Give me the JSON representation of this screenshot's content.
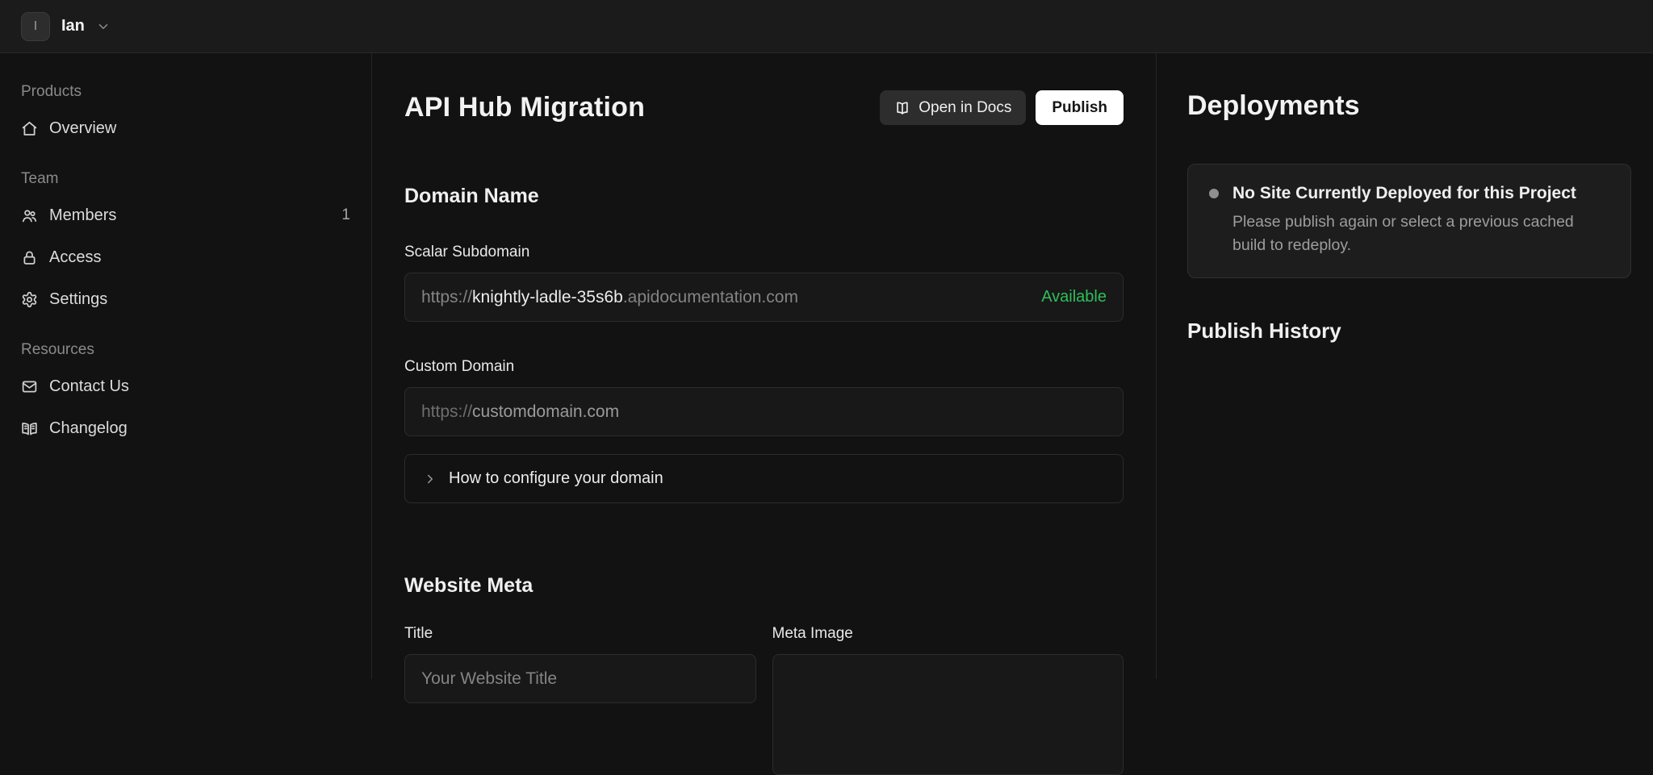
{
  "topbar": {
    "workspace_initial": "I",
    "workspace_name": "Ian"
  },
  "sidebar": {
    "sections": [
      {
        "header": "Products",
        "items": [
          {
            "label": "Overview",
            "icon": "home-icon"
          }
        ]
      },
      {
        "header": "Team",
        "items": [
          {
            "label": "Members",
            "icon": "users-icon",
            "badge": "1"
          },
          {
            "label": "Access",
            "icon": "lock-icon"
          },
          {
            "label": "Settings",
            "icon": "gear-icon"
          }
        ]
      },
      {
        "header": "Resources",
        "items": [
          {
            "label": "Contact Us",
            "icon": "mail-icon"
          },
          {
            "label": "Changelog",
            "icon": "book-icon"
          }
        ]
      }
    ]
  },
  "main": {
    "title": "API Hub Migration",
    "actions": {
      "open_in_docs": "Open in Docs",
      "publish": "Publish"
    },
    "domain": {
      "heading": "Domain Name",
      "subdomain_label": "Scalar Subdomain",
      "url_prefix": "https://",
      "subdomain_value": "knightly-ladle-35s6b",
      "subdomain_suffix": ".apidocumentation.com",
      "status": "Available",
      "custom_label": "Custom Domain",
      "custom_placeholder_prefix": "https://",
      "custom_placeholder_rest": "customdomain.com",
      "help_text": "How to configure your domain"
    },
    "meta": {
      "heading": "Website Meta",
      "title_label": "Title",
      "title_placeholder": "Your Website Title",
      "image_label": "Meta Image"
    }
  },
  "deployments": {
    "heading": "Deployments",
    "notice_title": "No Site Currently Deployed for this Project",
    "notice_body": "Please publish again or select a previous cached build to redeploy.",
    "history_heading": "Publish History"
  },
  "colors": {
    "available_green": "#2fbe5a",
    "publish_button_bg": "#ffffff",
    "page_background": "#121212",
    "topbar_background": "#1b1b1b",
    "card_background": "#1d1d1d"
  }
}
